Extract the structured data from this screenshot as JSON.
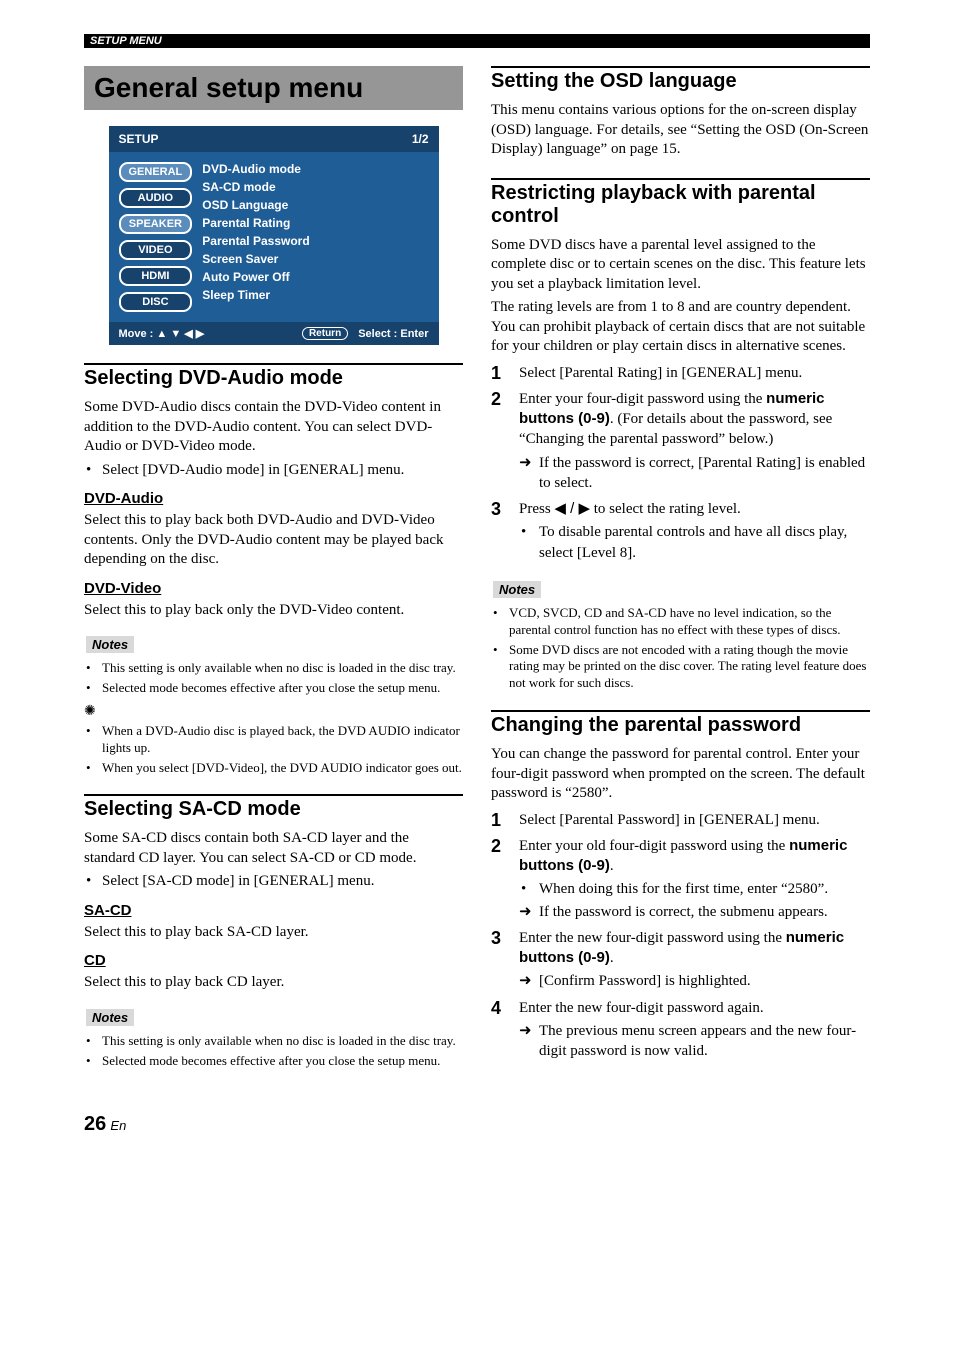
{
  "header": {
    "running": "SETUP MENU"
  },
  "title": "General setup menu",
  "osd": {
    "head_left": "SETUP",
    "head_right": "1/2",
    "tabs": [
      "GENERAL",
      "AUDIO",
      "SPEAKER",
      "VIDEO",
      "HDMI",
      "DISC"
    ],
    "items": [
      "DVD-Audio mode",
      "SA-CD mode",
      "OSD Language",
      "Parental Rating",
      "Parental Password",
      "Screen Saver",
      "Auto Power Off",
      "Sleep Timer"
    ],
    "foot_move": "Move :  ▲ ▼ ◀ ▶",
    "foot_return": "Return",
    "foot_select": "Select :   Enter"
  },
  "left": {
    "dvdaudio": {
      "title": "Selecting DVD-Audio mode",
      "intro": "Some DVD-Audio discs contain the DVD-Video content in addition to the DVD-Audio content. You can select DVD-Audio or DVD-Video mode.",
      "bullet": "Select [DVD-Audio mode] in [GENERAL] menu.",
      "opt1_h": "DVD-Audio",
      "opt1_t": "Select this to play back both DVD-Audio and DVD-Video contents. Only the DVD-Audio content may be played back depending on the disc.",
      "opt2_h": "DVD-Video",
      "opt2_t": "Select this to play back only the DVD-Video content.",
      "notes_label": "Notes",
      "note1": "This setting is only available when no disc is loaded in the disc tray.",
      "note2": "Selected mode becomes effective after you close the setup menu.",
      "tip1": "When a DVD-Audio disc is played back, the DVD AUDIO indicator lights up.",
      "tip2": "When you select [DVD-Video], the DVD AUDIO indicator goes out."
    },
    "sacd": {
      "title": "Selecting SA-CD mode",
      "intro": "Some SA-CD discs contain both SA-CD layer and the standard CD layer. You can select SA-CD or CD mode.",
      "bullet": "Select [SA-CD mode] in [GENERAL] menu.",
      "opt1_h": "SA-CD",
      "opt1_t": "Select this to play back SA-CD layer.",
      "opt2_h": "CD",
      "opt2_t": "Select this to play back CD layer.",
      "notes_label": "Notes",
      "note1": "This setting is only available when no disc is loaded in the disc tray.",
      "note2": "Selected mode becomes effective after you close the setup menu."
    }
  },
  "right": {
    "osdlang": {
      "title": "Setting the OSD language",
      "p": "This menu contains various options for the on-screen display (OSD) language. For details, see “Setting the OSD (On-Screen Display) language” on page 15."
    },
    "parental": {
      "title": "Restricting playback with parental control",
      "p1": "Some DVD discs have a parental level assigned to the complete disc or to certain scenes on the disc. This feature lets you set a playback limitation level.",
      "p2": "The rating levels are from 1 to 8 and are country dependent. You can prohibit playback of certain discs that are not suitable for your children or play certain discs in alternative scenes.",
      "s1": "Select [Parental Rating] in [GENERAL] menu.",
      "s2a": "Enter your four-digit password using the ",
      "s2b": "numeric buttons (0-9)",
      "s2c": ". (For details about the password, see “Changing the parental password” below.)",
      "s2_arrow": "If the password is correct, [Parental Rating] is enabled to select.",
      "s3a": "Press ",
      "s3b": " to select the rating level.",
      "s3_dot": "To disable parental controls and have all discs play, select [Level 8].",
      "notes_label": "Notes",
      "note1": "VCD, SVCD, CD and SA-CD have no level indication, so the parental control function has no effect with these types of discs.",
      "note2": "Some DVD discs are not encoded with a rating though the movie rating may be printed on the disc cover. The rating level feature does not work for such discs."
    },
    "password": {
      "title": "Changing the parental password",
      "p": "You can change the password for parental control. Enter your four-digit password when prompted on the screen. The default password is “2580”.",
      "s1": "Select [Parental Password] in [GENERAL] menu.",
      "s2a": "Enter your old four-digit password using the ",
      "s2b": "numeric buttons (0-9)",
      "s2c": ".",
      "s2_dot": "When doing this for the first time, enter “2580”.",
      "s2_arrow": "If the password is correct, the submenu appears.",
      "s3a": "Enter the new four-digit password using the ",
      "s3b": "numeric buttons (0-9)",
      "s3c": ".",
      "s3_arrow": "[Confirm Password] is highlighted.",
      "s4": "Enter the new four-digit password again.",
      "s4_arrow": "The previous menu screen appears and the new four-digit password is now valid."
    }
  },
  "footer": {
    "page": "26",
    "lang": "En"
  }
}
